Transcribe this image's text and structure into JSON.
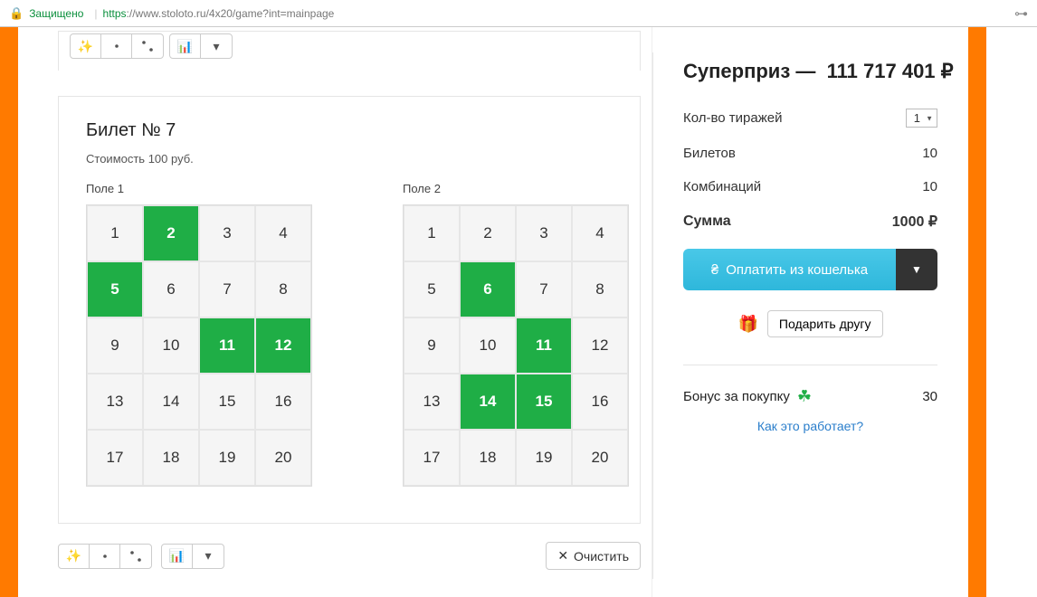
{
  "addr": {
    "secure": "Защищено",
    "proto": "https",
    "url": "://www.stoloto.ru/4x20/game?int=mainpage"
  },
  "ticket": {
    "title": "Билет № 7",
    "cost": "Стоимость 100 руб.",
    "field1_label": "Поле 1",
    "field2_label": "Поле 2",
    "numbers": [
      "1",
      "2",
      "3",
      "4",
      "5",
      "6",
      "7",
      "8",
      "9",
      "10",
      "11",
      "12",
      "13",
      "14",
      "15",
      "16",
      "17",
      "18",
      "19",
      "20"
    ],
    "field1_selected": [
      2,
      5,
      11,
      12
    ],
    "field2_selected": [
      6,
      11,
      14,
      15
    ]
  },
  "tools": {
    "clear": "Очистить"
  },
  "summary": {
    "super_label": "Суперприз —",
    "super_value": "111 717 401 ₽",
    "draws_label": "Кол-во тиражей",
    "draws_value": "1",
    "tickets_label": "Билетов",
    "tickets_value": "10",
    "combos_label": "Комбинаций",
    "combos_value": "10",
    "sum_label": "Сумма",
    "sum_value": "1000 ₽",
    "pay_label": "Оплатить из кошелька",
    "gift_label": "Подарить другу",
    "bonus_label": "Бонус за покупку",
    "bonus_value": "30",
    "how_link": "Как это работает?"
  }
}
